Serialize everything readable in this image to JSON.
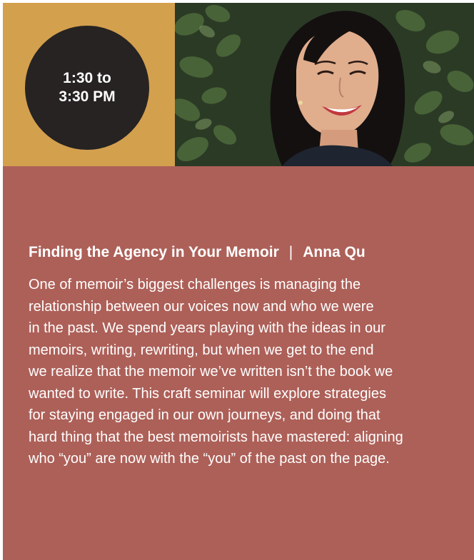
{
  "event": {
    "time_line1": "1:30 to",
    "time_line2": "3:30 PM",
    "title": "Finding the Agency in Your Memoir",
    "separator": "|",
    "speaker": "Anna Qu",
    "description_lines": [
      "One of memoir’s biggest challenges is managing the",
      "relationship between our voices now and who we were",
      "in the past. We spend years playing with the ideas in our",
      "memoirs, writing, rewriting, but when we get to the end",
      "we realize that the memoir we’ve written isn’t the book we",
      "wanted to write. This craft seminar will explore strategies",
      "for staying engaged in our own journeys, and doing that",
      "hard thing that the best memoirists have mastered: aligning",
      "who “you” are now with the “you” of the past on the page."
    ]
  },
  "colors": {
    "gold": "#d3a04e",
    "badge": "#262322",
    "content_bg": "#ad6058",
    "text": "#ffffff"
  },
  "images": {
    "speaker_photo": "smiling-woman-with-ivy-background"
  }
}
